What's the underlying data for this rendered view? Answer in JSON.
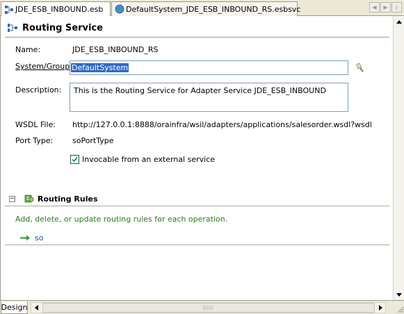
{
  "tabs": [
    {
      "label": "JDE_ESB_INBOUND.esb",
      "icon": "esb-diagram-icon",
      "active": true
    },
    {
      "label": "DefaultSystem_JDE_ESB_INBOUND_RS.esbsvc",
      "icon": "globe-service-icon",
      "active": false
    }
  ],
  "service": {
    "title": "Routing Service",
    "name_label": "Name:",
    "name_value": "JDE_ESB_INBOUND_RS",
    "system_group_label": "System/Group:",
    "system_group_value": "DefaultSystem",
    "description_label": "Description:",
    "description_value": "This is the Routing Service for Adapter Service JDE_ESB_INBOUND",
    "wsdl_label": "WSDL File:",
    "wsdl_value": "http://127.0.0.1:8888/orainfra/wsil/adapters/applications/salesorder.wsdl?wsdl",
    "port_type_label": "Port Type:",
    "port_type_value": "soPortType",
    "invocable_label": "Invocable from an external service",
    "invocable_checked": true
  },
  "routing_rules": {
    "title": "Routing Rules",
    "description": "Add, delete, or update routing rules for each operation.",
    "operations": [
      {
        "label": "so"
      }
    ]
  },
  "bottom": {
    "design_tab_label": "Design"
  },
  "colors": {
    "selection": "#316ac5",
    "rules_description": "#2c7a1e",
    "operation_link": "#1f4aa8",
    "header_rule": "#7f9db9"
  }
}
